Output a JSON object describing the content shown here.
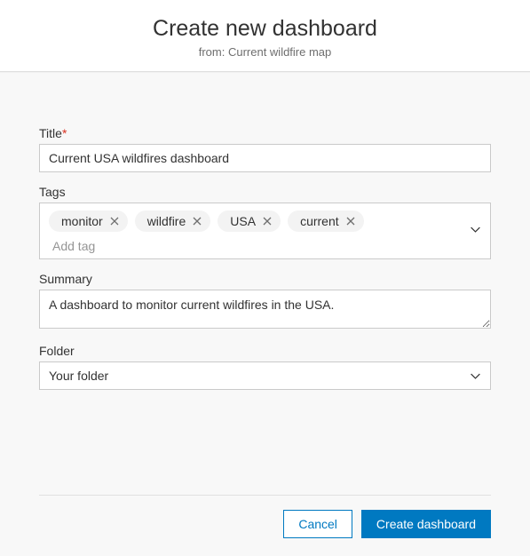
{
  "header": {
    "title": "Create new dashboard",
    "subtitle_prefix": "from: ",
    "subtitle_source": "Current wildfire map"
  },
  "form": {
    "title": {
      "label": "Title",
      "required_mark": "*",
      "value": "Current USA wildfires dashboard"
    },
    "tags": {
      "label": "Tags",
      "items": [
        "monitor",
        "wildfire",
        "USA",
        "current"
      ],
      "placeholder": "Add tag"
    },
    "summary": {
      "label": "Summary",
      "value": "A dashboard to monitor current wildfires in the USA."
    },
    "folder": {
      "label": "Folder",
      "value": "Your folder"
    }
  },
  "actions": {
    "cancel": "Cancel",
    "create": "Create dashboard"
  }
}
